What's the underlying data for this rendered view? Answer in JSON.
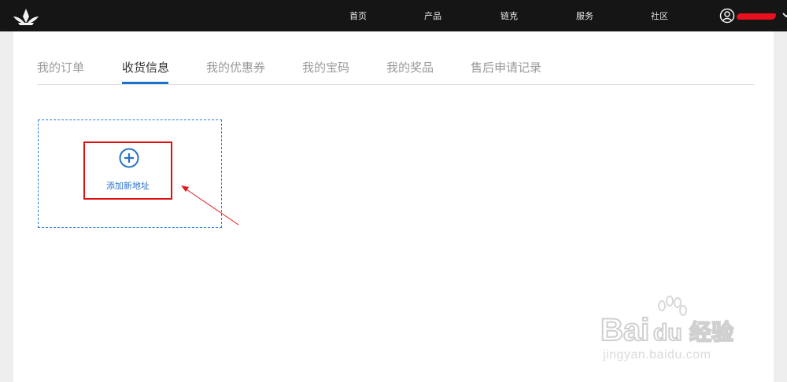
{
  "nav": {
    "items": [
      {
        "label": "首页"
      },
      {
        "label": "产品"
      },
      {
        "label": "链克"
      },
      {
        "label": "服务"
      },
      {
        "label": "社区"
      }
    ]
  },
  "tabs": [
    {
      "label": "我的订单",
      "active": false
    },
    {
      "label": "收货信息",
      "active": true
    },
    {
      "label": "我的优惠券",
      "active": false
    },
    {
      "label": "我的宝码",
      "active": false
    },
    {
      "label": "我的奖品",
      "active": false
    },
    {
      "label": "售后申请记录",
      "active": false
    }
  ],
  "address": {
    "add_label": "添加新地址"
  },
  "watermark": {
    "url": "jingyan.baidu.com"
  },
  "colors": {
    "topbar": "#151515",
    "accent": "#1a73c8",
    "highlight": "#e01010"
  }
}
